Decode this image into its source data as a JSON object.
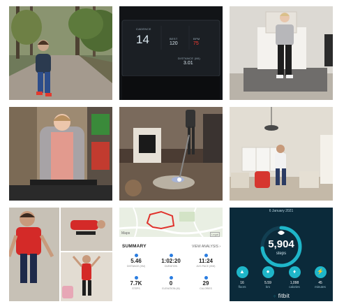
{
  "treadmill": {
    "cadence_label": "CADENCE",
    "cadence_value": "14",
    "best_label": "BEST",
    "best_value": "120",
    "heart_label": "BPM",
    "heart_value": "75",
    "distance_label": "DISTANCE (MI)",
    "distance_value": "3.01",
    "red_color": "#ff3b30"
  },
  "run_summary": {
    "maps_label": "Maps",
    "legal_label": "Legal",
    "title": "SUMMARY",
    "view_link": "VIEW ANALYSIS",
    "stats": [
      {
        "value": "5.46",
        "label": "DISTANCE (KM)"
      },
      {
        "value": "1:02:20",
        "label": "DURATION"
      },
      {
        "value": "11:24",
        "label": "AVG PACE (/KM)"
      },
      {
        "value": "7.7K",
        "label": "STEPS"
      },
      {
        "value": "0",
        "label": "ELEVATION (M)"
      },
      {
        "value": "29",
        "label": "CALORIES"
      }
    ],
    "accent_color": "#2a7de1",
    "route_color": "#e0322c"
  },
  "fitbit": {
    "date": "6 January 2021",
    "steps_value": "5,904",
    "steps_label": "steps",
    "brand": "fitbit",
    "ring_color": "#1fb6c9",
    "stats": [
      {
        "icon": "stairs-icon",
        "glyph": "▲",
        "value": "16",
        "label": "floors"
      },
      {
        "icon": "location-icon",
        "glyph": "●",
        "value": "5.59",
        "label": "km"
      },
      {
        "icon": "flame-icon",
        "glyph": "♦",
        "value": "1,098",
        "label": "calories"
      },
      {
        "icon": "bolt-icon",
        "glyph": "⚡",
        "value": "45",
        "label": "minutes"
      }
    ]
  }
}
